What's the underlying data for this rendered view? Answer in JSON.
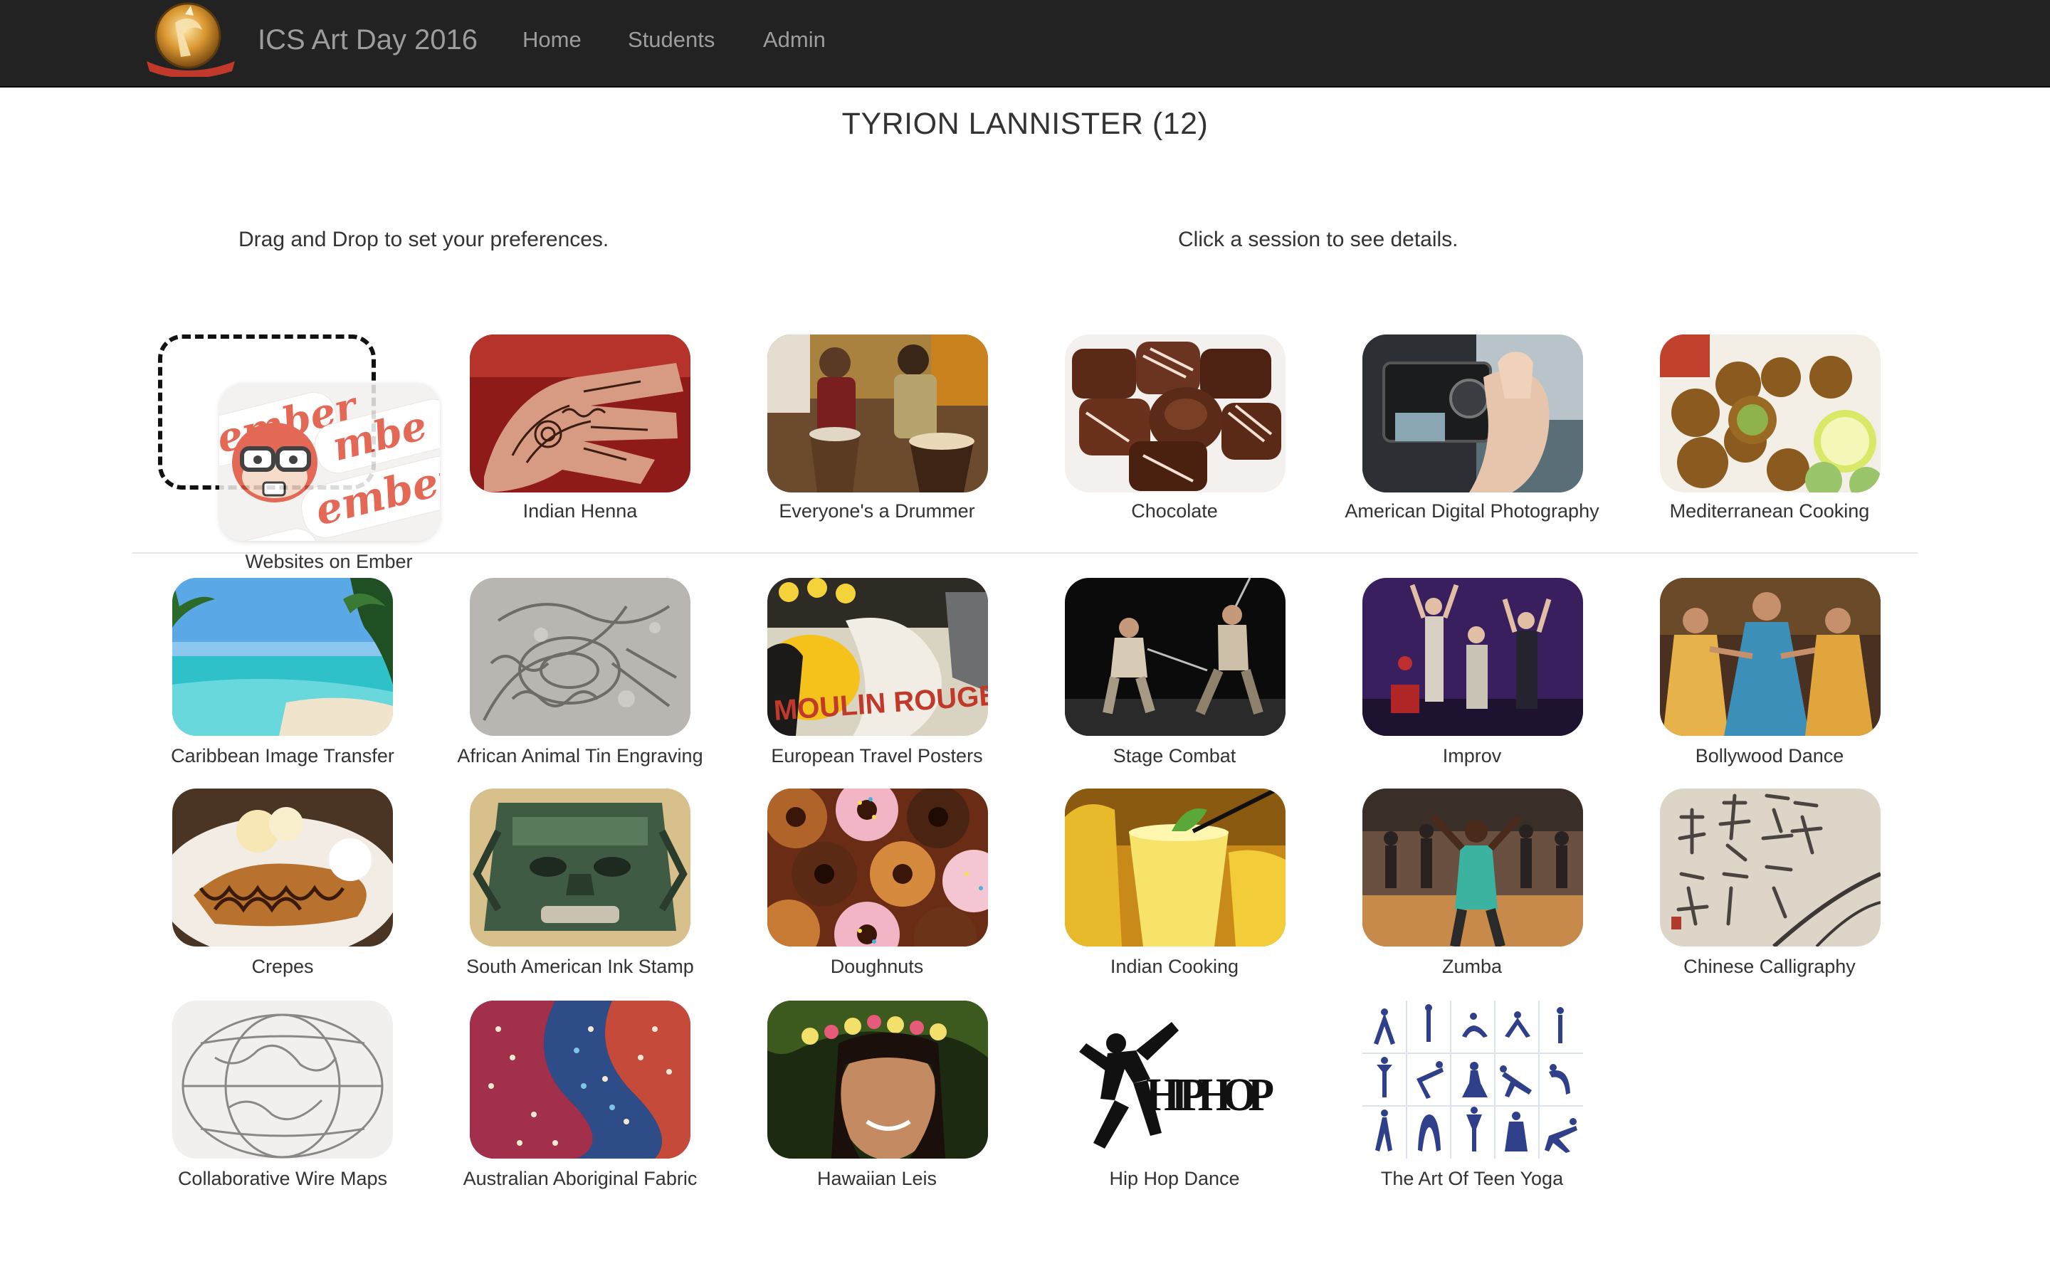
{
  "navbar": {
    "brand": "ICS Art Day 2016",
    "logo_icon": "school-crest-logo",
    "links": [
      "Home",
      "Students",
      "Admin"
    ]
  },
  "student": {
    "name_heading": "TYRION LANNISTER (12)"
  },
  "instructions": {
    "left": "Drag and Drop to set your preferences.",
    "right": "Click a session to see details."
  },
  "dragged_session": {
    "label": "Websites on Ember"
  },
  "sessions": [
    "Indian Henna",
    "Everyone's a Drummer",
    "Chocolate",
    "American Digital Photography",
    "Mediterranean Cooking",
    "Caribbean Image Transfer",
    "African Animal Tin Engraving",
    "European Travel Posters",
    "Stage Combat",
    "Improv",
    "Bollywood Dance",
    "Crepes",
    "South American Ink Stamp",
    "Doughnuts",
    "Indian Cooking",
    "Zumba",
    "Chinese Calligraphy",
    "Collaborative Wire Maps",
    "Australian Aboriginal Fabric",
    "Hawaiian Leis",
    "Hip Hop Dance",
    "The Art Of Teen Yoga"
  ],
  "image_texts": {
    "ember_logo": [
      "ember",
      "ember",
      "ember",
      "ber",
      "mbe"
    ],
    "moulin_rouge": "MOULIN ROUGE",
    "hip_hop": "HIP HOP"
  }
}
